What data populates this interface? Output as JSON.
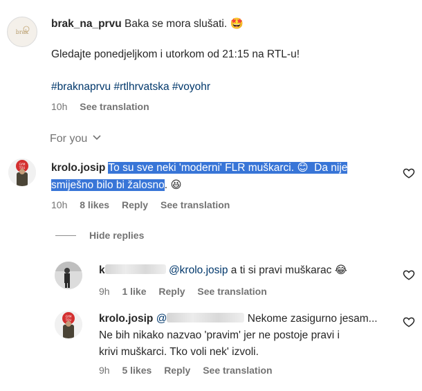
{
  "caption": {
    "username": "brak_na_prvu",
    "text": "Baka se mora slušati.",
    "emoji": "🤩",
    "line2": "Gledajte ponedjeljkom i utorkom od 21:15 na RTL-u!",
    "hashtags": "#braknaprvu #rtlhrvatska #voyohr",
    "time": "10h",
    "see_translation": "See translation"
  },
  "section_label": "For you",
  "comment1": {
    "username": "krolo.josip",
    "text_line1": "To su sve neki 'moderni' FLR muškarci.",
    "emoji1": "😊",
    "text_line1b": "Da nije",
    "text_line2": "smiješno bilo bi žalosno",
    "text_line2_end": ".",
    "emoji2": "😆",
    "time": "10h",
    "likes": "8 likes",
    "reply": "Reply",
    "see_translation": "See translation"
  },
  "hide_replies": "Hide replies",
  "reply1": {
    "username_prefix": "k",
    "mention": "@krolo.josip",
    "text": "a ti si pravi muškarac",
    "emoji": "😂",
    "time": "9h",
    "likes": "1 like",
    "reply": "Reply",
    "see_translation": "See translation"
  },
  "reply2": {
    "username": "krolo.josip",
    "mention_prefix": "@",
    "text_line1": "Nekome zasigurno jesam...",
    "text_line2": "Ne bih nikako nazvao 'pravim' jer ne postoje pravi i",
    "text_line3": "krivi muškarci. Tko voli nek' izvoli.",
    "time": "9h",
    "likes": "5 likes",
    "reply": "Reply",
    "see_translation": "See translation"
  },
  "colors": {
    "selection": "#3875d7",
    "link": "#00376b",
    "muted": "#737373"
  }
}
